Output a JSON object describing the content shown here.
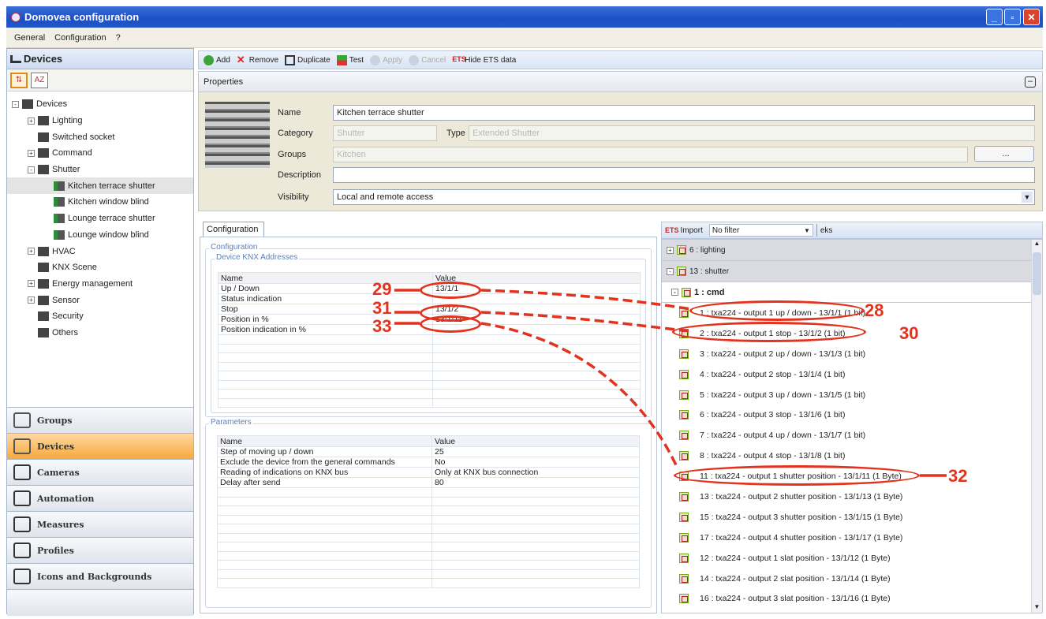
{
  "window": {
    "title": "Domovea configuration"
  },
  "menu": [
    "General",
    "Configuration",
    "?"
  ],
  "left": {
    "header": "Devices",
    "tree": [
      {
        "label": "Devices",
        "level": 0,
        "exp": "-"
      },
      {
        "label": "Lighting",
        "level": 1,
        "exp": "+"
      },
      {
        "label": "Switched socket",
        "level": 1,
        "exp": ""
      },
      {
        "label": "Command",
        "level": 1,
        "exp": "+"
      },
      {
        "label": "Shutter",
        "level": 1,
        "exp": "-"
      },
      {
        "label": "Kitchen terrace shutter",
        "level": 2,
        "exp": "",
        "selected": true
      },
      {
        "label": "Kitchen window blind",
        "level": 2,
        "exp": ""
      },
      {
        "label": "Lounge terrace shutter",
        "level": 2,
        "exp": ""
      },
      {
        "label": "Lounge window blind",
        "level": 2,
        "exp": ""
      },
      {
        "label": "HVAC",
        "level": 1,
        "exp": "+"
      },
      {
        "label": "KNX Scene",
        "level": 1,
        "exp": ""
      },
      {
        "label": "Energy management",
        "level": 1,
        "exp": "+"
      },
      {
        "label": "Sensor",
        "level": 1,
        "exp": "+"
      },
      {
        "label": "Security",
        "level": 1,
        "exp": ""
      },
      {
        "label": "Others",
        "level": 1,
        "exp": ""
      }
    ],
    "nav": [
      {
        "label": "Groups"
      },
      {
        "label": "Devices",
        "active": true
      },
      {
        "label": "Cameras"
      },
      {
        "label": "Automation"
      },
      {
        "label": "Measures"
      },
      {
        "label": "Profiles"
      },
      {
        "label": "Icons and Backgrounds"
      }
    ]
  },
  "toolbar": {
    "add": "Add",
    "remove": "Remove",
    "duplicate": "Duplicate",
    "test": "Test",
    "apply": "Apply",
    "cancel": "Cancel",
    "hide_ets": "Hide ETS data"
  },
  "properties": {
    "header": "Properties",
    "name_label": "Name",
    "name_value": "Kitchen terrace shutter",
    "category_label": "Category",
    "category_value": "Shutter",
    "type_label": "Type",
    "type_value": "Extended Shutter",
    "groups_label": "Groups",
    "groups_value": "Kitchen",
    "groups_button": "...",
    "description_label": "Description",
    "description_value": "",
    "visibility_label": "Visibility",
    "visibility_value": "Local and remote access"
  },
  "config": {
    "tab": "Configuration",
    "group_title": "Configuration",
    "knx_title": "Device KNX Addresses",
    "knx_headers": {
      "name": "Name",
      "value": "Value"
    },
    "knx_rows": [
      {
        "name": "Up / Down",
        "value": "13/1/1"
      },
      {
        "name": "Status indication",
        "value": ""
      },
      {
        "name": "Stop",
        "value": "13/1/2"
      },
      {
        "name": "Position in %",
        "value": "13/1/11"
      },
      {
        "name": "Position indication in %",
        "value": ""
      }
    ],
    "params_title": "Parameters",
    "param_headers": {
      "name": "Name",
      "value": "Value"
    },
    "param_rows": [
      {
        "name": "Step of moving up / down",
        "value": "25"
      },
      {
        "name": "Exclude the device from the general commands",
        "value": "No"
      },
      {
        "name": "Reading of indications on KNX bus",
        "value": "Only at KNX bus connection"
      },
      {
        "name": "Delay after send",
        "value": "80"
      }
    ]
  },
  "ets": {
    "import_label": "Import",
    "filter_value": "No filter",
    "search_value": "eks",
    "groups": [
      {
        "label": "6 : lighting",
        "exp": "+"
      },
      {
        "label": "13 : shutter",
        "exp": "-"
      }
    ],
    "subgroup": "1 : cmd",
    "items": [
      "1 : txa224 - output 1 up / down - 13/1/1 (1 bit)",
      "2 : txa224 - output 1 stop - 13/1/2 (1 bit)",
      "3 : txa224 - output 2 up / down - 13/1/3 (1 bit)",
      "4 : txa224 - output 2 stop - 13/1/4 (1 bit)",
      "5 : txa224 - output 3 up / down - 13/1/5 (1 bit)",
      "6 : txa224 - output 3 stop - 13/1/6 (1 bit)",
      "7 : txa224 - output 4 up / down - 13/1/7 (1 bit)",
      "8 : txa224 - output 4 stop - 13/1/8 (1 bit)",
      "11 : txa224 - output 1 shutter position - 13/1/11 (1 Byte)",
      "13 : txa224 - output 2 shutter position - 13/1/13 (1 Byte)",
      "15 : txa224 - output 3 shutter position - 13/1/15 (1 Byte)",
      "17 : txa224 - output 4 shutter position - 13/1/17 (1 Byte)",
      "12 : txa224 - output 1 slat position - 13/1/12 (1 Byte)",
      "14 : txa224 - output 2 slat position - 13/1/14 (1 Byte)",
      "16 : txa224 - output 3 slat position - 13/1/16 (1 Byte)"
    ]
  },
  "annotations": {
    "a29": "29",
    "a31": "31",
    "a33": "33",
    "a28": "28",
    "a30": "30",
    "a32": "32"
  },
  "colors": {
    "accent": "#e2331f",
    "title_bar": "#1b4fc4",
    "active_nav": "#f6a83d"
  }
}
